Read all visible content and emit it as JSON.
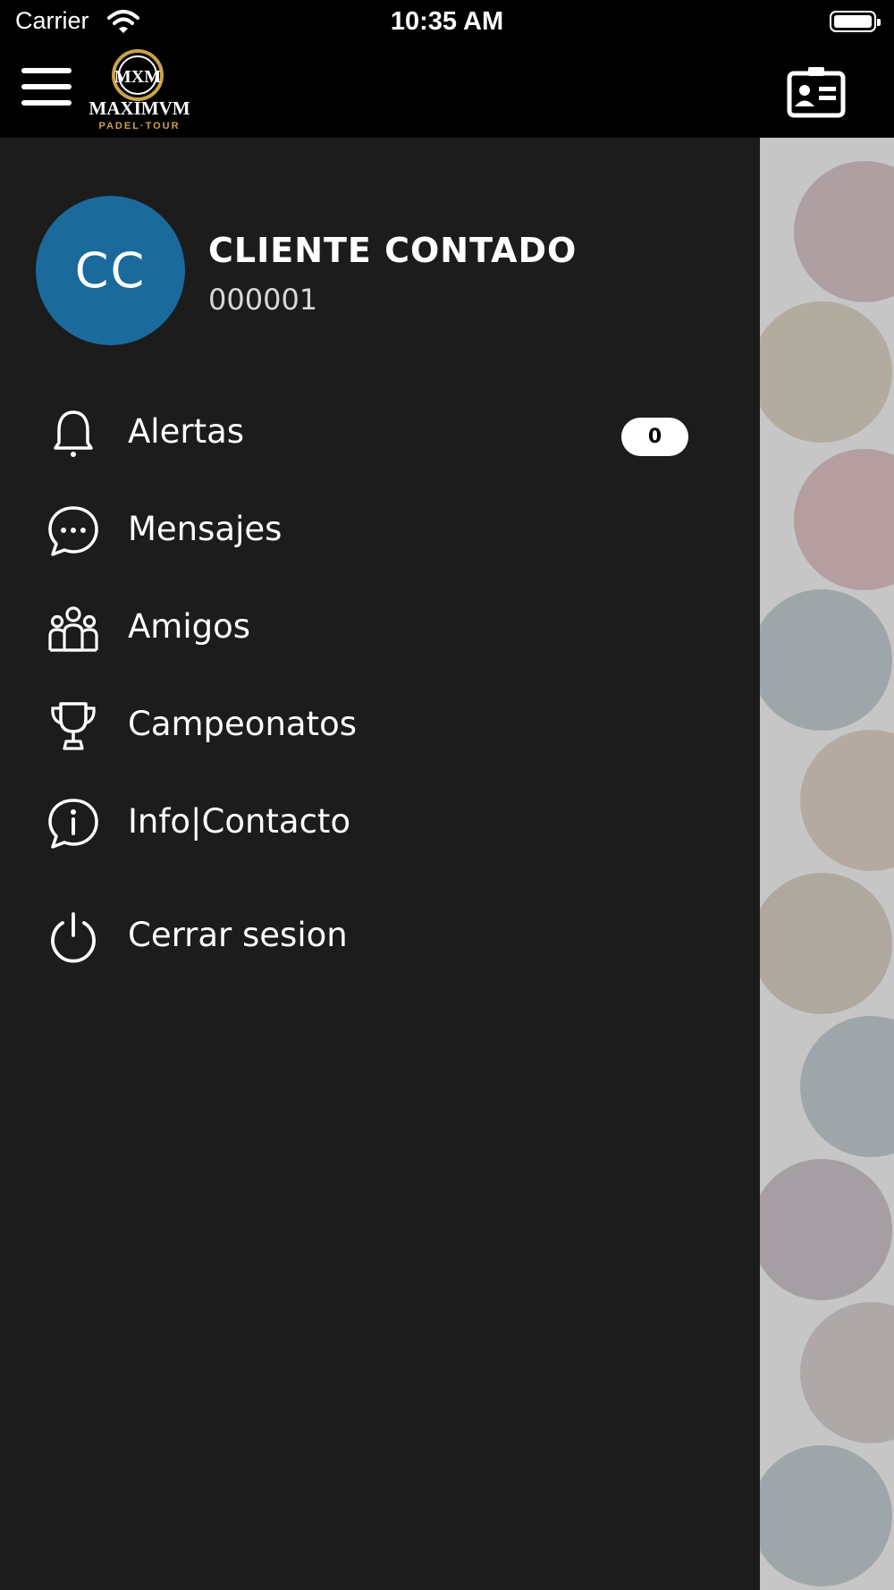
{
  "status_bar": {
    "carrier": "Carrier",
    "time": "10:35 AM"
  },
  "nav": {
    "logo_text": "MAXIMVM",
    "logo_subtext": "PADEL·TOUR",
    "logo_monogram": "MXM"
  },
  "profile": {
    "initials": "CC",
    "name": "CLIENTE CONTADO",
    "id": "000001"
  },
  "menu": {
    "items": [
      {
        "label": "Alertas",
        "icon": "bell-icon",
        "badge": "0"
      },
      {
        "label": "Mensajes",
        "icon": "chat-bubble-icon"
      },
      {
        "label": "Amigos",
        "icon": "group-icon"
      },
      {
        "label": "Campeonatos",
        "icon": "trophy-icon"
      },
      {
        "label": "Info|Contacto",
        "icon": "info-bubble-icon"
      },
      {
        "label": "Cerrar sesion",
        "icon": "power-icon"
      }
    ]
  },
  "colors": {
    "avatar": "#1b6a9c",
    "drawer": "#1c1c1c",
    "logo_gold": "#c9a24a"
  }
}
